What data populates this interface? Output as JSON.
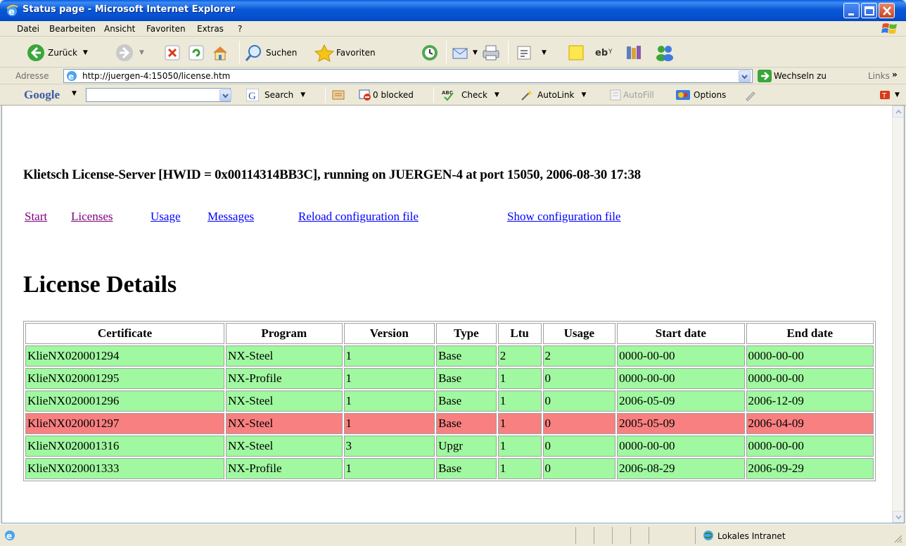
{
  "window": {
    "title": "Status page - Microsoft Internet Explorer"
  },
  "menu": {
    "items": [
      "Datei",
      "Bearbeiten",
      "Ansicht",
      "Favoriten",
      "Extras",
      "?"
    ]
  },
  "toolbar": {
    "back_label": "Zurück",
    "search_label": "Suchen",
    "favorites_label": "Favoriten"
  },
  "address": {
    "label": "Adresse",
    "url": "http://juergen-4:15050/license.htm",
    "go_label": "Wechseln zu",
    "links_label": "Links"
  },
  "googlebar": {
    "logo": "Google",
    "search_label": "Search",
    "blocked_label": "0 blocked",
    "check_label": "Check",
    "autolink_label": "AutoLink",
    "autofill_label": "AutoFill",
    "options_label": "Options"
  },
  "page": {
    "heading": "Klietsch License-Server [HWID = 0x00114314BB3C], running on JUERGEN-4 at port 15050, 2006-08-30 17:38",
    "nav": [
      "Start",
      "Licenses",
      "Usage",
      "Messages",
      "Reload configuration file",
      "Show configuration file"
    ],
    "section_title": "License Details",
    "table": {
      "headers": [
        "Certificate",
        "Program",
        "Version",
        "Type",
        "Ltu",
        "Usage",
        "Start date",
        "End date"
      ],
      "rows": [
        {
          "status": "ok",
          "cells": [
            "KlieNX020001294",
            "NX-Steel",
            "1",
            "Base",
            "2",
            "2",
            "0000-00-00",
            "0000-00-00"
          ]
        },
        {
          "status": "ok",
          "cells": [
            "KlieNX020001295",
            "NX-Profile",
            "1",
            "Base",
            "1",
            "0",
            "0000-00-00",
            "0000-00-00"
          ]
        },
        {
          "status": "ok",
          "cells": [
            "KlieNX020001296",
            "NX-Steel",
            "1",
            "Base",
            "1",
            "0",
            "2006-05-09",
            "2006-12-09"
          ]
        },
        {
          "status": "expired",
          "cells": [
            "KlieNX020001297",
            "NX-Steel",
            "1",
            "Base",
            "1",
            "0",
            "2005-05-09",
            "2006-04-09"
          ]
        },
        {
          "status": "ok",
          "cells": [
            "KlieNX020001316",
            "NX-Steel",
            "3",
            "Upgr",
            "1",
            "0",
            "0000-00-00",
            "0000-00-00"
          ]
        },
        {
          "status": "ok",
          "cells": [
            "KlieNX020001333",
            "NX-Profile",
            "1",
            "Base",
            "1",
            "0",
            "2006-08-29",
            "2006-09-29"
          ]
        }
      ]
    }
  },
  "statusbar": {
    "zone": "Lokales Intranet"
  },
  "colors": {
    "row_ok": "#a0f8a0",
    "row_expired": "#f88080",
    "link": "#0000ff",
    "visited": "#800080"
  }
}
